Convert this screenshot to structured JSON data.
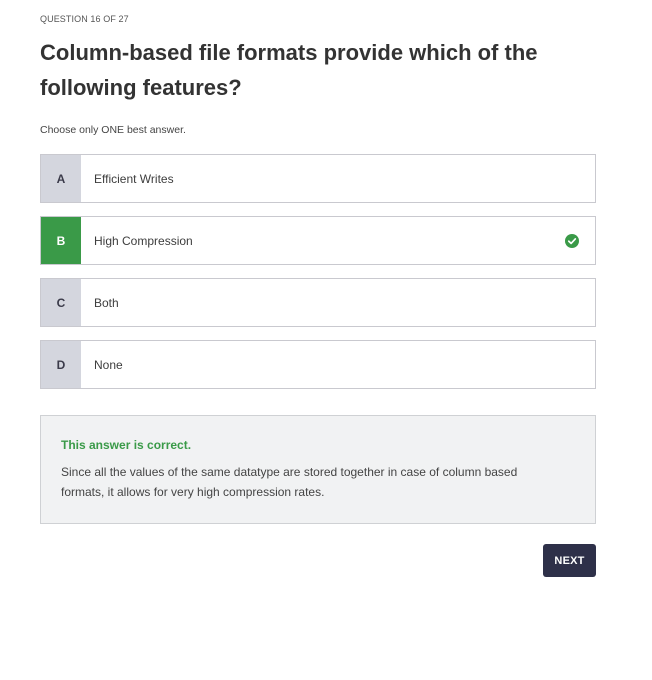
{
  "header": {
    "counter": "QUESTION 16 OF 27"
  },
  "question": {
    "text": "Column-based file formats provide which of the following features?",
    "instruction": "Choose only ONE best answer."
  },
  "options": [
    {
      "letter": "A",
      "label": "Efficient Writes",
      "correct": false
    },
    {
      "letter": "B",
      "label": "High Compression",
      "correct": true
    },
    {
      "letter": "C",
      "label": "Both",
      "correct": false
    },
    {
      "letter": "D",
      "label": "None",
      "correct": false
    }
  ],
  "feedback": {
    "status": "This answer is correct.",
    "explanation": "Since all the values of the same datatype are stored together in case of column based formats, it allows for very high compression rates."
  },
  "footer": {
    "next_label": "NEXT"
  },
  "colors": {
    "correct": "#3a9a48",
    "letter_bg": "#d4d6de",
    "button_bg": "#2e3049"
  },
  "icons": {
    "correct_mark": "check-circle-icon"
  }
}
